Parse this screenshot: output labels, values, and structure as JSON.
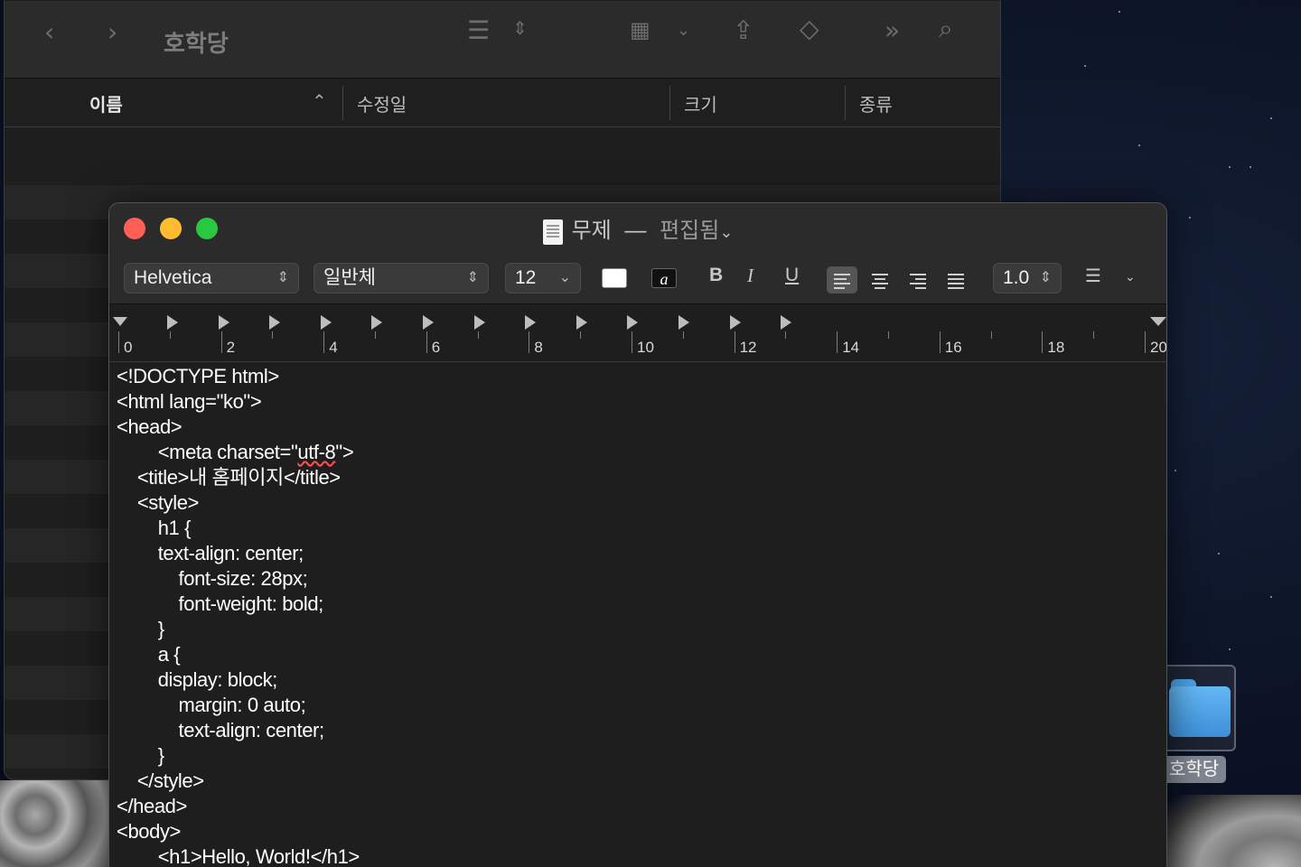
{
  "finder": {
    "title": "호학당",
    "columns": {
      "name": "이름",
      "modified": "수정일",
      "size": "크기",
      "kind": "종류"
    }
  },
  "textedit": {
    "title": "무제",
    "separator": "—",
    "edited": "편집됨",
    "font_family": "Helvetica",
    "font_style": "일반체",
    "font_size": "12",
    "line_spacing": "1.0",
    "bold": "B",
    "italic": "I",
    "underline": "U",
    "text_color": "#ffffff",
    "highlight_letter": "a",
    "ruler_labels": [
      "0",
      "2",
      "4",
      "6",
      "8",
      "10",
      "12",
      "14",
      "16",
      "18",
      "20"
    ],
    "code_lines": [
      "<!DOCTYPE html>",
      "<html lang=\"ko\">",
      "<head>",
      "        <meta charset=\"utf-8\">",
      "    <title>내 홈페이지</title>",
      "    <style>",
      "        h1 {",
      "        text-align: center;",
      "            font-size: 28px;",
      "            font-weight: bold;",
      "        }",
      "        a {",
      "        display: block;",
      "            margin: 0 auto;",
      "            text-align: center;",
      "        }",
      "    </style>",
      "</head>",
      "<body>",
      "        <h1>Hello, World!</h1>"
    ]
  },
  "desktop": {
    "folder_label": "호학당"
  },
  "colors": {
    "close": "#ff5f57",
    "minimize": "#febc2e",
    "zoom": "#28c840",
    "folder": "#4aa1e2"
  }
}
